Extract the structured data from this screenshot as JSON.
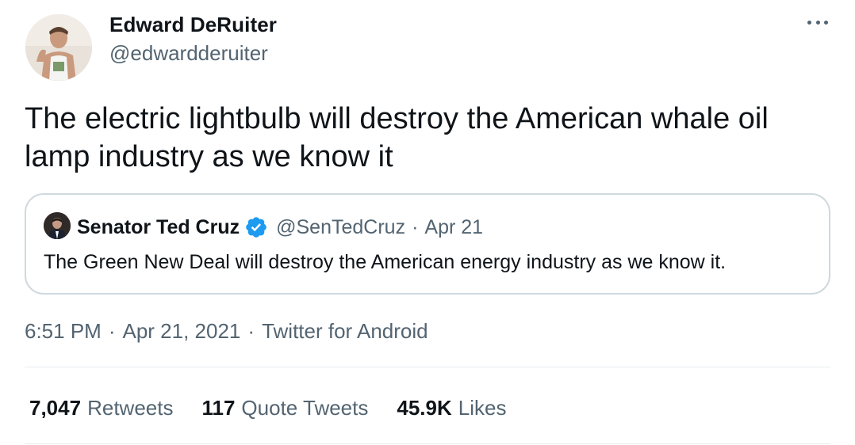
{
  "author": {
    "name": "Edward DeRuiter",
    "handle": "@edwardderuiter"
  },
  "tweet_text": "The electric lightbulb will destroy the American whale oil lamp industry as we know it",
  "quoted": {
    "name": "Senator Ted Cruz",
    "handle": "@SenTedCruz",
    "separator": "·",
    "date": "Apr 21",
    "text": "The Green New Deal will destroy the American energy industry as we know it."
  },
  "meta": {
    "time": "6:51 PM",
    "separator": "·",
    "date": "Apr 21, 2021",
    "source": "Twitter for Android"
  },
  "stats": {
    "retweets": {
      "count": "7,047",
      "label": "Retweets"
    },
    "quotes": {
      "count": "117",
      "label": "Quote Tweets"
    },
    "likes": {
      "count": "45.9K",
      "label": "Likes"
    }
  },
  "icons": {
    "more": "more-horizontal-icon",
    "verified": "verified-badge-icon"
  },
  "colors": {
    "text": "#0f1419",
    "secondary": "#536471",
    "border": "#cfd9de",
    "verified": "#1d9bf0"
  }
}
